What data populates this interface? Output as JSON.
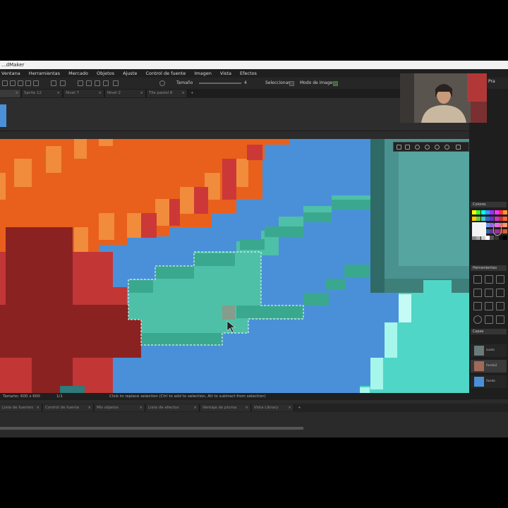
{
  "window": {
    "title": "...dMaker"
  },
  "menu": [
    "Ventana",
    "Herramientas",
    "Mercado",
    "Objetos",
    "Ajuste",
    "Control de fuente",
    "Imagen",
    "Vista",
    "Efectos"
  ],
  "toolbar": {
    "size_label": "Tamaño",
    "size_value": "4",
    "selection_label": "Seleccionar",
    "mode_label": "Modo de imagen"
  },
  "tabs": [
    {
      "label": "",
      "active": true
    },
    {
      "label": "Sprite 12",
      "active": false
    },
    {
      "label": "Nivel 7",
      "active": false
    },
    {
      "label": "Nivel 2",
      "active": false
    },
    {
      "label": "Tile pastel 8",
      "active": false
    }
  ],
  "status": {
    "size": "Tamaño: 600 x 600",
    "zoom": "1/1",
    "hint": "Click to replace selection (Ctrl to add to selection, Alt to subtract from selection)"
  },
  "bottom_tabs": [
    "Lista de fuentes",
    "Control de fuente",
    "Mis objetos",
    "Lista de efectos",
    "Ventaja de pluma",
    "Vista Library"
  ],
  "right_panel": {
    "colors_label": "Colores",
    "tools_label": "Herramientas",
    "layers_label": "Capas",
    "layers": [
      {
        "name": "suelo",
        "selected": false
      },
      {
        "name": "fondo2",
        "selected": true
      },
      {
        "name": "fondo",
        "selected": false
      }
    ]
  },
  "webcam": {
    "label": "Pra"
  },
  "palette": [
    "#ffff00",
    "#33ff33",
    "#00ffff",
    "#3399ff",
    "#9933ff",
    "#ff33ff",
    "#ff3333",
    "#ff9933",
    "#ffcc00",
    "#66cc33",
    "#33cccc",
    "#3366cc",
    "#6633cc",
    "#cc33cc",
    "#cc3333",
    "#ff6633",
    "#ffe066",
    "#99ee66",
    "#66dddd",
    "#6699ee",
    "#9966ee",
    "#ee66ee",
    "#ee6666",
    "#ff9966",
    "#cccc33",
    "#339933",
    "#339999",
    "#336699",
    "#663399",
    "#993399",
    "#993333",
    "#cc6633",
    "#888888",
    "#aaaaaa",
    "#cccccc",
    "#ffffff",
    "#555555",
    "#333333",
    "#111111",
    "#000000"
  ],
  "colors": {
    "sea": "#4a90d9",
    "teal": "#4ec0a8",
    "teal_dark": "#3a9a84",
    "orange": "#e8601c",
    "dark_red": "#8a2222",
    "cyan": "#5fe3d4"
  }
}
